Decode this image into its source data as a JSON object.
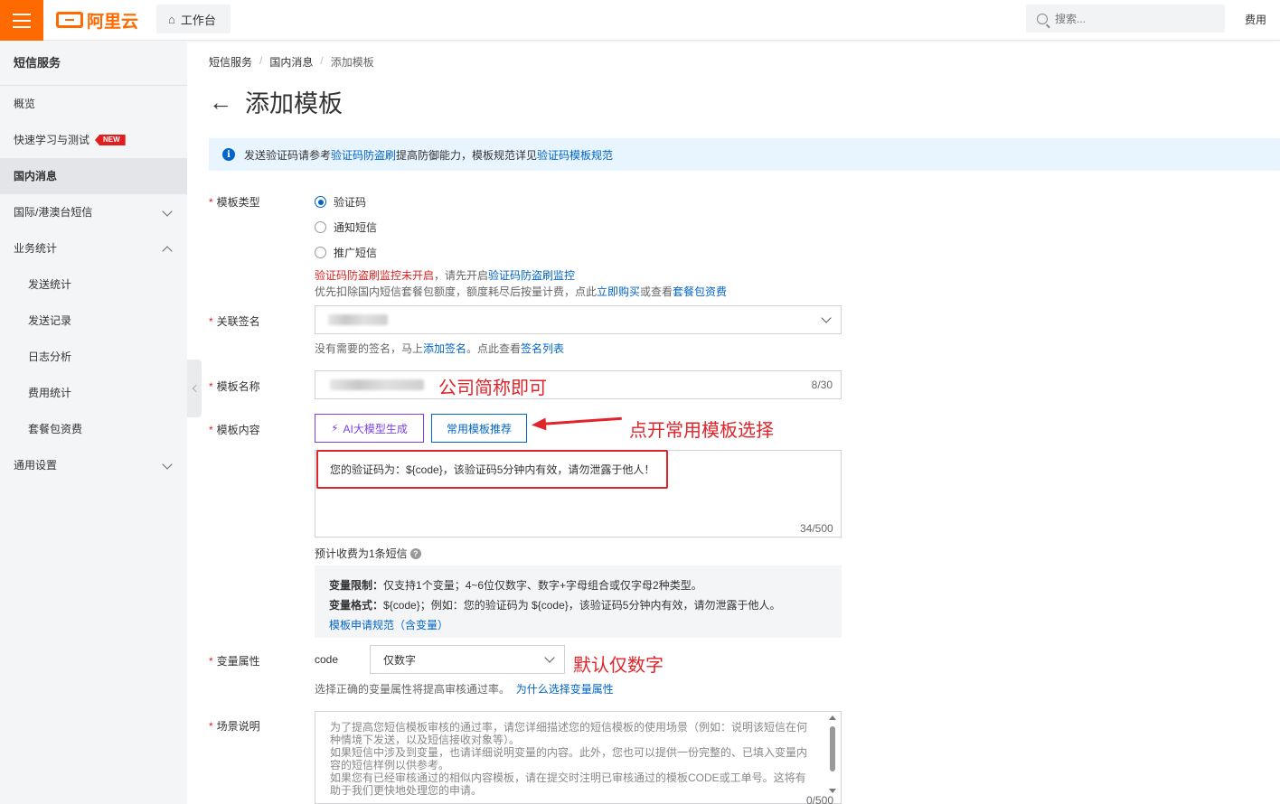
{
  "topbar": {
    "logo_text": "阿里云",
    "workbench_label": "工作台",
    "search_placeholder": "搜索...",
    "cost_label": "费用"
  },
  "sidebar": {
    "title": "短信服务",
    "items": [
      {
        "label": "概览"
      },
      {
        "label": "快速学习与测试",
        "badge": "NEW"
      },
      {
        "label": "国内消息"
      },
      {
        "label": "国际/港澳台短信"
      },
      {
        "label": "业务统计"
      },
      {
        "label": "发送统计"
      },
      {
        "label": "发送记录"
      },
      {
        "label": "日志分析"
      },
      {
        "label": "费用统计"
      },
      {
        "label": "套餐包资费"
      },
      {
        "label": "通用设置"
      }
    ]
  },
  "breadcrumb": [
    "短信服务",
    "国内消息",
    "添加模板"
  ],
  "breadcrumb_sep": "/",
  "page_title": "添加模板",
  "notice": {
    "prefix": "发送验证码请参考",
    "link1": "验证码防盗刷",
    "middle": "提高防御能力，模板规范详见",
    "link2": "验证码模板规范"
  },
  "form": {
    "template_type": {
      "label": "模板类型",
      "options": [
        "验证码",
        "通知短信",
        "推广短信"
      ],
      "selected": "验证码",
      "warn_text": "验证码防盗刷监控未开启",
      "warn_mid": "，请先开启",
      "warn_link": "验证码防盗刷监控",
      "help_prefix": "优先扣除国内短信套餐包额度，额度耗尽后按量计费，点此",
      "help_link1": "立即购买",
      "help_mid": "或查看",
      "help_link2": "套餐包资费"
    },
    "signature": {
      "label": "关联签名",
      "help_prefix": "没有需要的签名，马上",
      "help_link1": "添加签名",
      "help_mid": "。点此查看",
      "help_link2": "签名列表"
    },
    "template_name": {
      "label": "模板名称",
      "counter": "8/30"
    },
    "template_content": {
      "label": "模板内容",
      "ai_button": "AI大模型生成",
      "common_button": "常用模板推荐",
      "value": "您的验证码为：${code}，该验证码5分钟内有效，请勿泄露于他人！",
      "counter": "34/500",
      "fee_text": "预计收费为1条短信"
    },
    "rules": {
      "limit_label": "变量限制：",
      "limit_text": "仅支持1个变量；4~6位仅数字、数字+字母组合或仅字母2种类型。",
      "format_label": "变量格式：",
      "format_text": "${code}；例如：您的验证码为 ${code}，该验证码5分钟内有效，请勿泄露于他人。",
      "link": "模板申请规范（含变量）"
    },
    "variable_attr": {
      "label": "变量属性",
      "var_name": "code",
      "selected": "仅数字",
      "help_prefix": "选择正确的变量属性将提高审核通过率。",
      "help_link": "为什么选择变量属性"
    },
    "scene": {
      "label": "场景说明",
      "placeholder_lines": [
        "为了提高您短信模板审核的通过率，请您详细描述您的短信模板的使用场景（例如：说明该短信在何种情境下发送，以及短信接收对象等）。",
        "如果短信中涉及到变量，也请详细说明变量的内容。此外，您也可以提供一份完整的、已填入变量内容的短信样例以供参考。",
        "如果您有已经审核通过的相似内容模板，请在提交时注明已审核通过的模板CODE或工单号。这将有助于我们更快地处理您的申请。"
      ],
      "counter": "0/500"
    }
  },
  "annotations": {
    "name_hint": "公司简称即可",
    "template_hint": "点开常用模板选择",
    "attr_hint": "默认仅数字"
  },
  "colors": {
    "brand": "#ff6a00",
    "link": "#0064c8",
    "annotation_red": "#e0242a",
    "ai_purple": "#7b3fe4"
  }
}
